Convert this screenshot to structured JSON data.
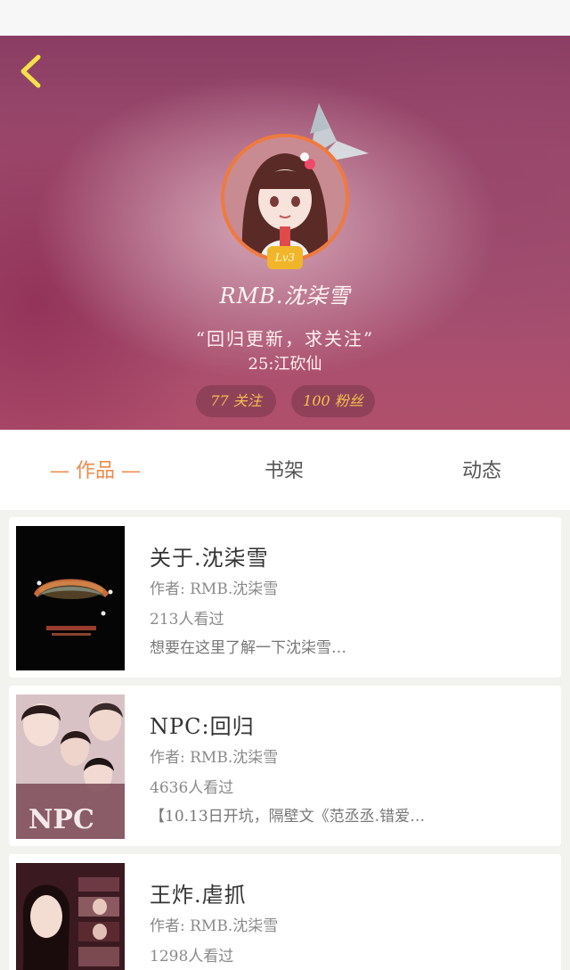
{
  "profile": {
    "level": "Lv3",
    "username": "RMB.沈柒雪",
    "signature": "“回归更新，求关注”",
    "signature_line2": "25:江砍仙",
    "follow_label": "77 关注",
    "fans_label": "100 粉丝"
  },
  "tabs": {
    "works": "— 作品 —",
    "shelf": "书架",
    "activity": "动态"
  },
  "books": [
    {
      "title": "关于.沈柒雪",
      "author": "作者: RMB.沈柒雪",
      "views": "213人看过",
      "desc": "想要在这里了解一下沈柒雪…"
    },
    {
      "title": "NPC:回归",
      "author": "作者: RMB.沈柒雪",
      "views": "4636人看过",
      "desc": "【10.13日开坑，隔壁文《范丞丞.错爱…"
    },
    {
      "title": "王炸.虐抓",
      "author": "作者: RMB.沈柒雪",
      "views": "1298人看过",
      "desc": ""
    }
  ],
  "colors": {
    "accent_orange": "#ee8a4a",
    "pill_text": "#f4c04e",
    "level_badge": "#f1b52a",
    "avatar_border": "#f07a3c"
  },
  "icons": {
    "back": "chevron-left-icon",
    "crown": "crown-icon"
  }
}
